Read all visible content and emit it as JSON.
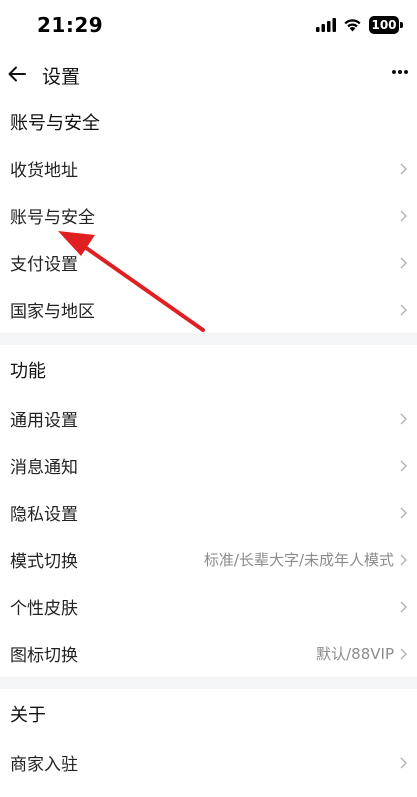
{
  "status": {
    "time": "21:29",
    "battery": "100"
  },
  "nav": {
    "title": "设置"
  },
  "sections": [
    {
      "title": "账号与安全",
      "items": [
        {
          "label": "收货地址",
          "value": ""
        },
        {
          "label": "账号与安全",
          "value": ""
        },
        {
          "label": "支付设置",
          "value": ""
        },
        {
          "label": "国家与地区",
          "value": ""
        }
      ]
    },
    {
      "title": "功能",
      "items": [
        {
          "label": "通用设置",
          "value": ""
        },
        {
          "label": "消息通知",
          "value": ""
        },
        {
          "label": "隐私设置",
          "value": ""
        },
        {
          "label": "模式切换",
          "value": "标准/长辈大字/未成年人模式"
        },
        {
          "label": "个性皮肤",
          "value": ""
        },
        {
          "label": "图标切换",
          "value": "默认/88VIP"
        }
      ]
    },
    {
      "title": "关于",
      "items": [
        {
          "label": "商家入驻",
          "value": ""
        }
      ]
    }
  ],
  "colors": {
    "annotation_arrow": "#e02020",
    "section_gap": "#f4f5f7"
  }
}
